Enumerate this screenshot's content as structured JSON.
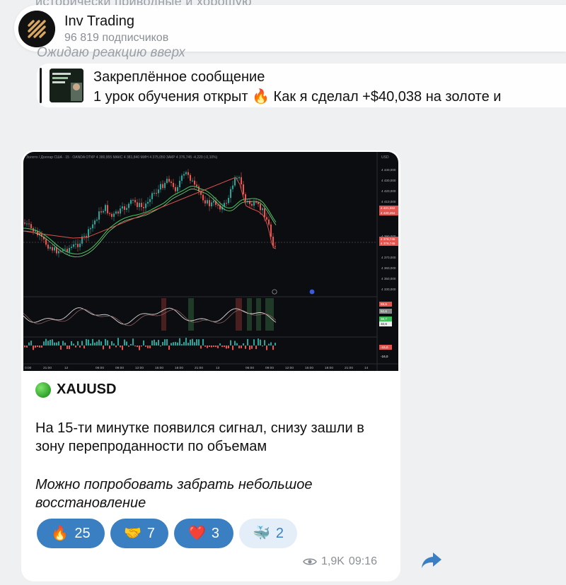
{
  "prev_message": {
    "top_text": "исторически приводные и хорошую",
    "italic_text": "Ожидаю реакцию вверх"
  },
  "header": {
    "channel_name": "Inv Trading",
    "subscribers": "96 819 подписчиков"
  },
  "pinned": {
    "title": "Закреплённое сообщение",
    "text": "1 урок обучения открыт 🔥 Как я сделал +$40,038 на золоте и"
  },
  "message": {
    "title": "XAUUSD",
    "body": "На 15-ти минутке появился сигнал, снизу зашли в зону перепроданности по объемам",
    "italic": "Можно попробовать забрать небольшое восстановление",
    "views": "1,9K",
    "time": "09:16"
  },
  "reactions": [
    {
      "emoji": "🔥",
      "count": "25",
      "active": true
    },
    {
      "emoji": "🤝",
      "count": "7",
      "active": true
    },
    {
      "emoji": "❤️",
      "count": "3",
      "active": true
    },
    {
      "emoji": "🐳",
      "count": "2",
      "active": false
    }
  ],
  "chart_info": {
    "header_text": "Золото / Доллар США · 15 · OANDA  ОТКР 4 380,955  МАКС 4 381,840  МИН 4 375,050  ЗАКР 4 376,745  -4,220 (-0,10%)",
    "currency": "USD",
    "price_ticks": [
      "4 440,000",
      "4 430,000",
      "4 420,000",
      "4 410,000",
      "4 390,000",
      "4 370,000",
      "4 360,000",
      "4 350,000",
      "4 340,000",
      "4 330,000"
    ],
    "price_labels": [
      "4 421,552",
      "4 420,454",
      "4 378,745",
      "4 376,745"
    ],
    "indicator_labels": [
      "69,6",
      "52,6",
      "36,7",
      "32,6",
      "-15,0",
      "-16,0"
    ],
    "time_ticks": [
      "0:00",
      "21:00",
      "12",
      "06:00",
      "09:00",
      "12:00",
      "15:00",
      "18:00",
      "21:00",
      "13",
      "06:00",
      "09:00",
      "12:00",
      "15:00",
      "18:00",
      "21:00",
      "14"
    ],
    "colors": {
      "up": "#26a69a",
      "down": "#ef5350",
      "ma_green": "#3fbf5a",
      "ma_red": "#d9534f"
    }
  }
}
